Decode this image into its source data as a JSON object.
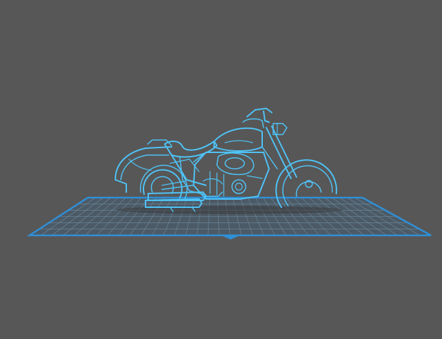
{
  "viewer": {
    "background_color": "#575757",
    "build_plate": {
      "fill_color": "#4c5a66",
      "grid_color": "#6b8799",
      "edge_color": "#2f8fd6",
      "front_marker_color": "#2f8fd6"
    },
    "model": {
      "name": "motorcycle-lithophane-model",
      "line_color": "#4fc3f7",
      "shadow_color": "#3a3a3a"
    },
    "icons": [
      "front-marker-icon"
    ]
  }
}
